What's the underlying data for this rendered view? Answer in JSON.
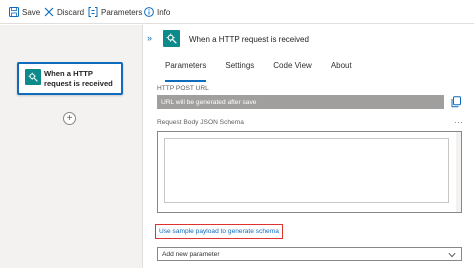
{
  "toolbar": {
    "save": "Save",
    "discard": "Discard",
    "parameters": "Parameters",
    "info": "Info"
  },
  "canvas": {
    "trigger_title": "When a HTTP request is received",
    "add_symbol": "+"
  },
  "panel": {
    "collapse_symbol": "»",
    "title": "When a HTTP request is received",
    "tabs": [
      "Parameters",
      "Settings",
      "Code View",
      "About"
    ],
    "active_tab": "Parameters",
    "url_label": "HTTP POST URL",
    "url_value": "URL will be generated after save",
    "schema_label": "Request Body JSON Schema",
    "schema_value": "",
    "more_symbol": "···",
    "sample_link": "Use sample payload to generate schema",
    "add_param_placeholder": "Add new parameter"
  },
  "colors": {
    "accent": "#0f6cbd",
    "icon_teal": "#0d8a8a",
    "highlight_red": "#e03131",
    "disabled_field": "#a19f9d"
  },
  "icons": {
    "save": "save-icon",
    "discard": "close-icon",
    "parameters": "parameters-icon",
    "info": "info-icon",
    "trigger": "http-request-icon",
    "copy": "copy-icon",
    "dropdown": "chevron-down-icon"
  }
}
